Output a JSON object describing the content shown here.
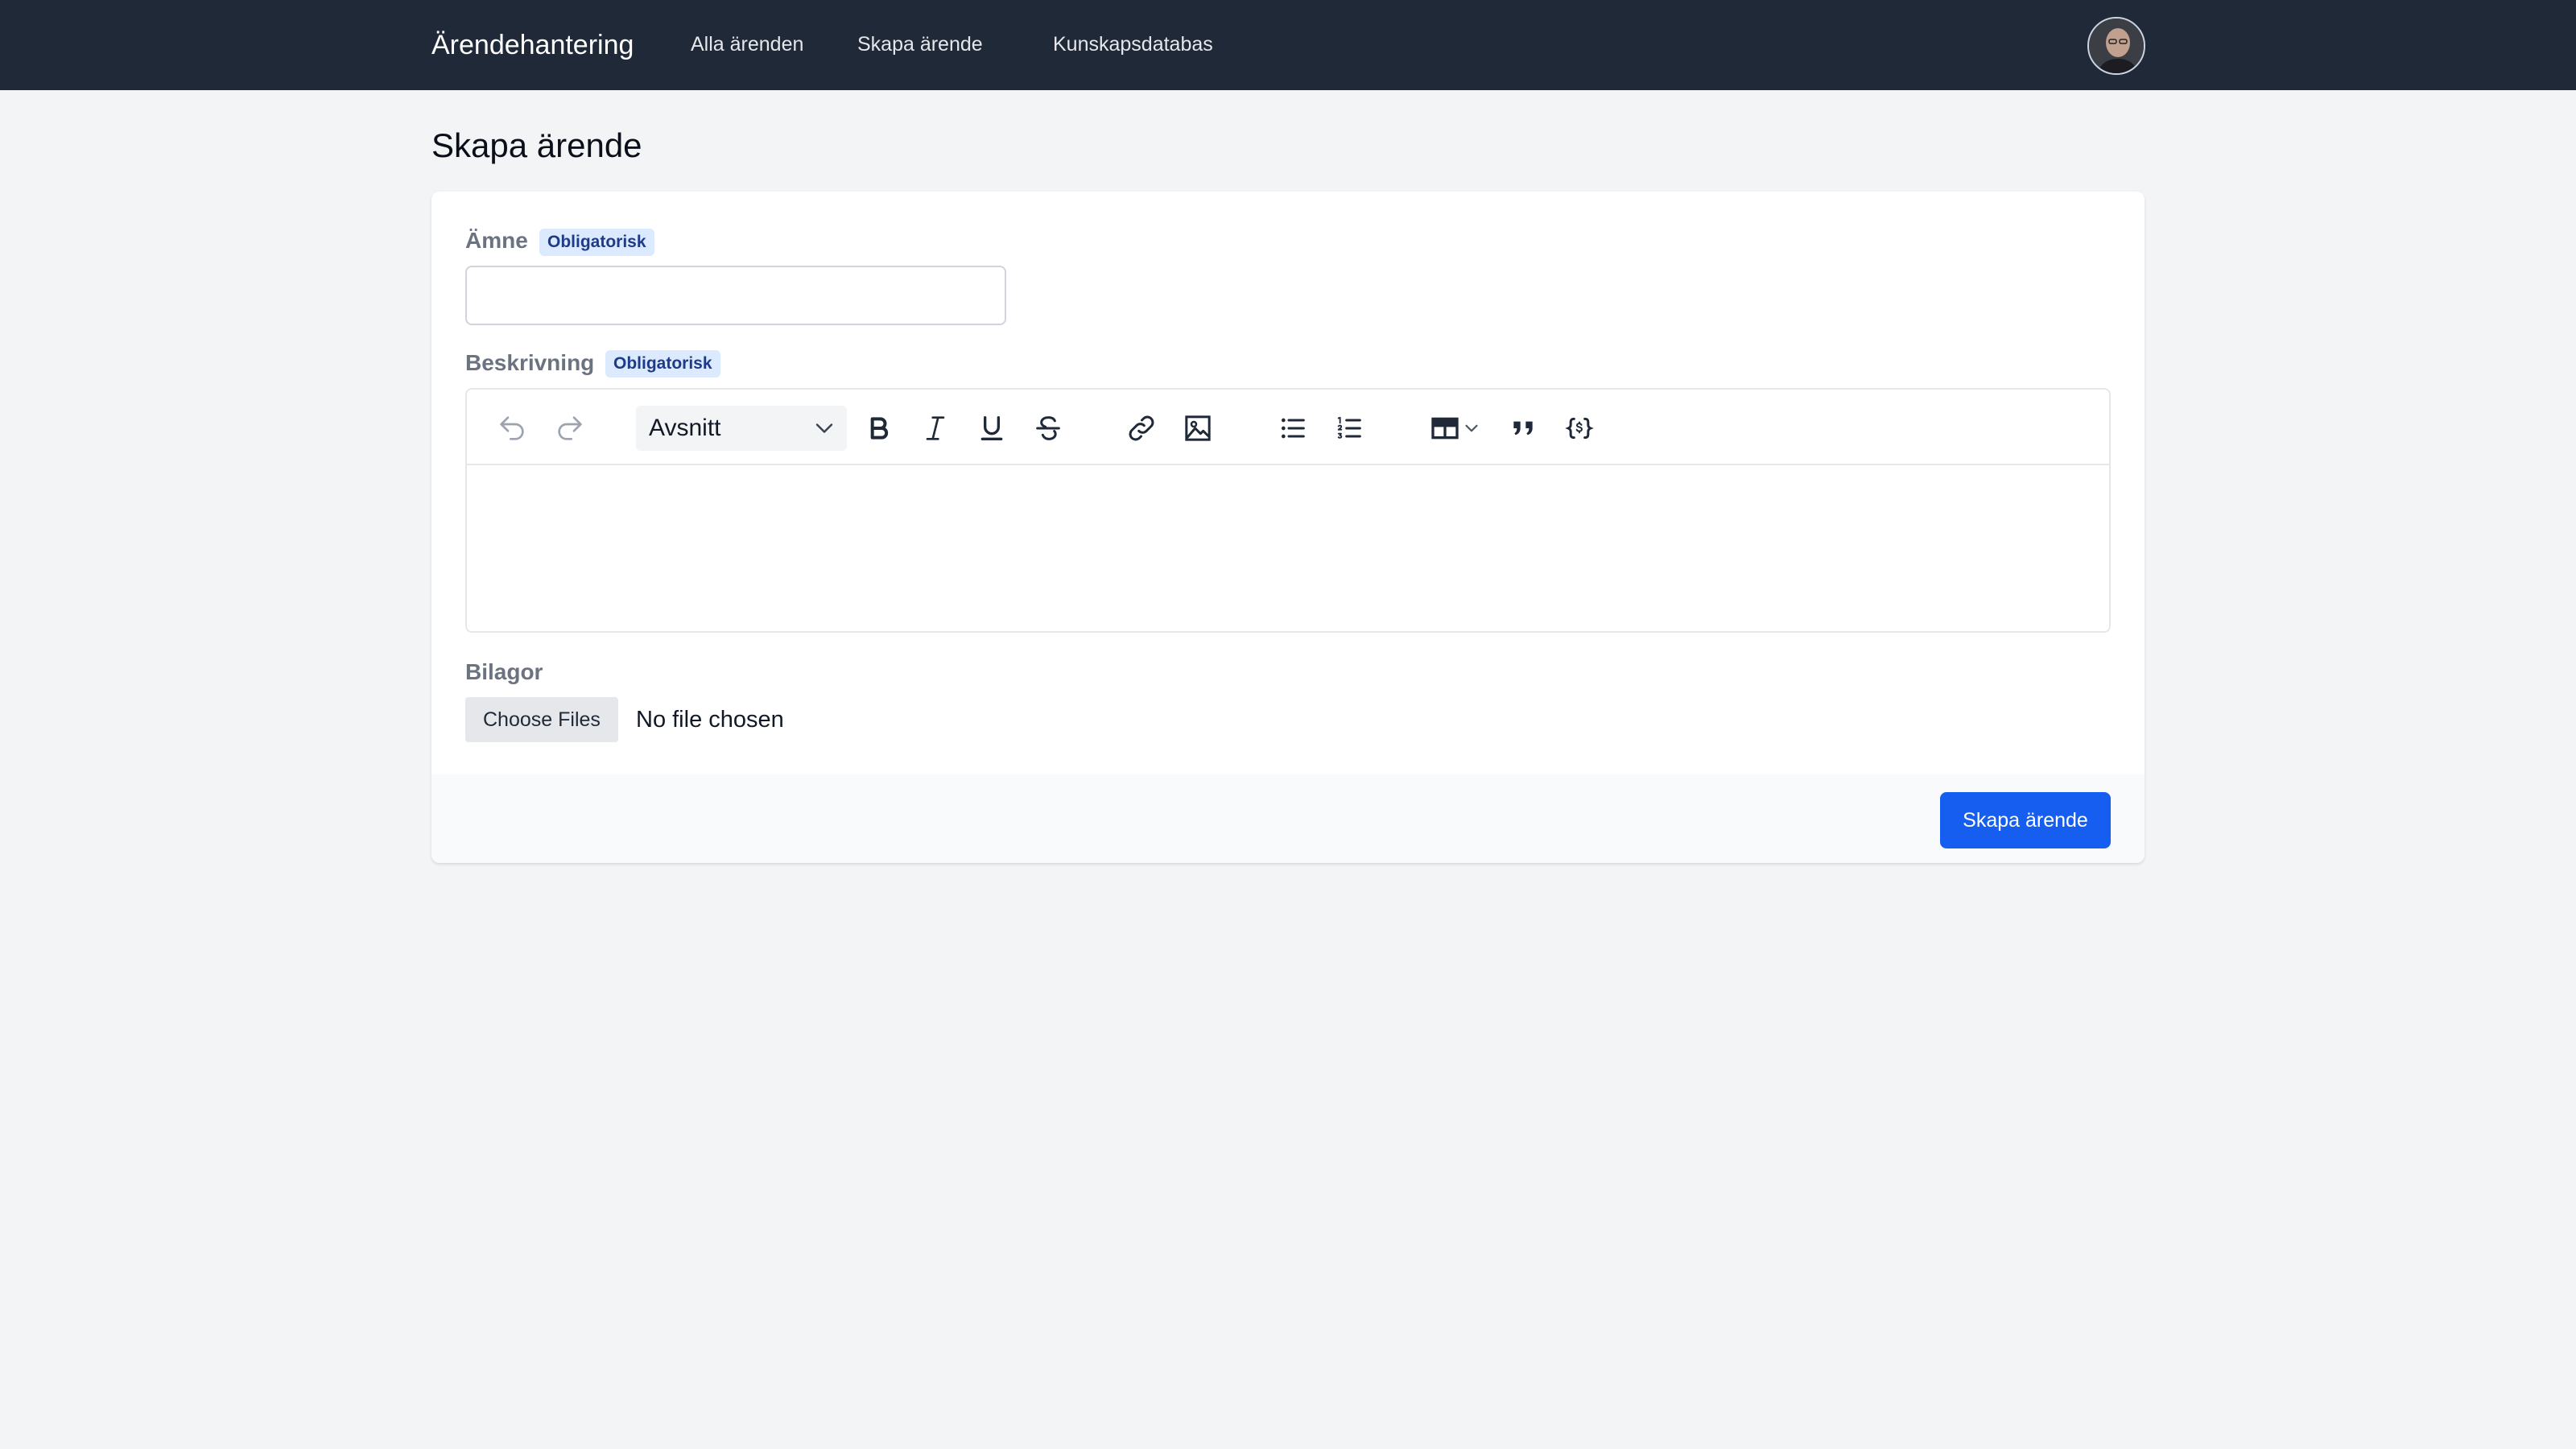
{
  "nav": {
    "brand": "Ärendehantering",
    "links": [
      "Alla ärenden",
      "Skapa ärende",
      "Kunskapsdatabas"
    ]
  },
  "page": {
    "title": "Skapa ärende"
  },
  "form": {
    "subject": {
      "label": "Ämne",
      "badge": "Obligatorisk",
      "value": "",
      "placeholder": ""
    },
    "description": {
      "label": "Beskrivning",
      "badge": "Obligatorisk",
      "block_style": "Avsnitt",
      "toolbar": [
        "undo-icon",
        "redo-icon",
        "bold-icon",
        "italic-icon",
        "underline-icon",
        "strikethrough-icon",
        "link-icon",
        "image-icon",
        "bulleted-list-icon",
        "numbered-list-icon",
        "table-icon",
        "quote-icon",
        "code-block-icon"
      ]
    },
    "attachments": {
      "label": "Bilagor",
      "button": "Choose Files",
      "status": "No file chosen"
    },
    "submit_label": "Skapa ärende"
  },
  "colors": {
    "topbar": "#1f2937",
    "primary": "#155eef",
    "badge_bg": "#dbeafe",
    "badge_text": "#1e3a8a"
  }
}
